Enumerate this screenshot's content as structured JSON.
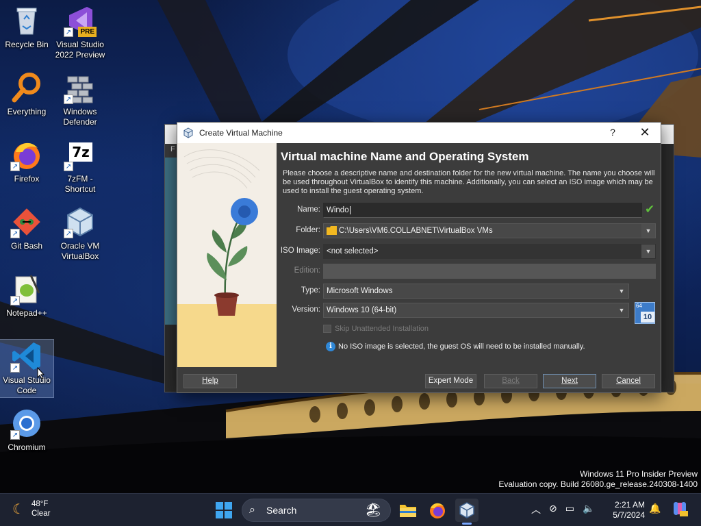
{
  "desktop": {
    "icons": [
      {
        "label": "Recycle Bin"
      },
      {
        "label": "Visual Studio 2022 Preview",
        "badge": "PRE"
      },
      {
        "label": "Everything"
      },
      {
        "label": "Windows Defender"
      },
      {
        "label": "Firefox"
      },
      {
        "label": "7zFM - Shortcut",
        "glyph": "7z"
      },
      {
        "label": "Git Bash"
      },
      {
        "label": "Oracle VM VirtualBox"
      },
      {
        "label": "Notepad++"
      },
      {
        "label": "Visual Studio Code"
      },
      {
        "label": "Chromium"
      }
    ],
    "shortcut_arrow": "↗"
  },
  "background_window": {
    "menu_letter": "F"
  },
  "dialog": {
    "title": "Create Virtual Machine",
    "help_glyph": "?",
    "close_glyph": "✕",
    "heading": "Virtual machine Name and Operating System",
    "description": "Please choose a descriptive name and destination folder for the new virtual machine. The name you choose will be used throughout VirtualBox to identify this machine. Additionally, you can select an ISO image which may be used to install the guest operating system.",
    "fields": {
      "name": {
        "label": "Name:",
        "value": "Windo",
        "valid_glyph": "✔"
      },
      "folder": {
        "label": "Folder:",
        "value": "C:\\Users\\VM6.COLLABNET\\VirtualBox VMs"
      },
      "iso": {
        "label": "ISO Image:",
        "value": "<not selected>"
      },
      "edition": {
        "label": "Edition:",
        "value": ""
      },
      "type": {
        "label": "Type:",
        "value": "Microsoft Windows"
      },
      "version": {
        "label": "Version:",
        "value": "Windows 10 (64-bit)"
      }
    },
    "os_badge": {
      "top": "64",
      "bottom": "10"
    },
    "skip_unattended": "Skip Unattended Installation",
    "info_glyph": "i",
    "info_message": "No ISO image is selected, the guest OS will need to be installed manually.",
    "buttons": {
      "help": "Help",
      "expert": "Expert Mode",
      "back": "Back",
      "next": "Next",
      "cancel": "Cancel"
    }
  },
  "watermark": {
    "line1": "Windows 11 Pro Insider Preview",
    "line2": "Evaluation copy. Build 26080.ge_release.240308-1400"
  },
  "taskbar": {
    "weather": {
      "temp": "48°F",
      "condition": "Clear"
    },
    "search_placeholder": "Search",
    "clock": {
      "time": "2:21 AM",
      "date": "5/7/2024"
    },
    "tray_icons": [
      "chevron-up-icon",
      "network-off-icon",
      "display-icon",
      "volume-icon"
    ]
  },
  "colors": {
    "dialog_bg": "#3c3c3c",
    "accent_check": "#5fc13c",
    "info_blue": "#2f88d8",
    "taskbar_bg": "#1d2230"
  }
}
